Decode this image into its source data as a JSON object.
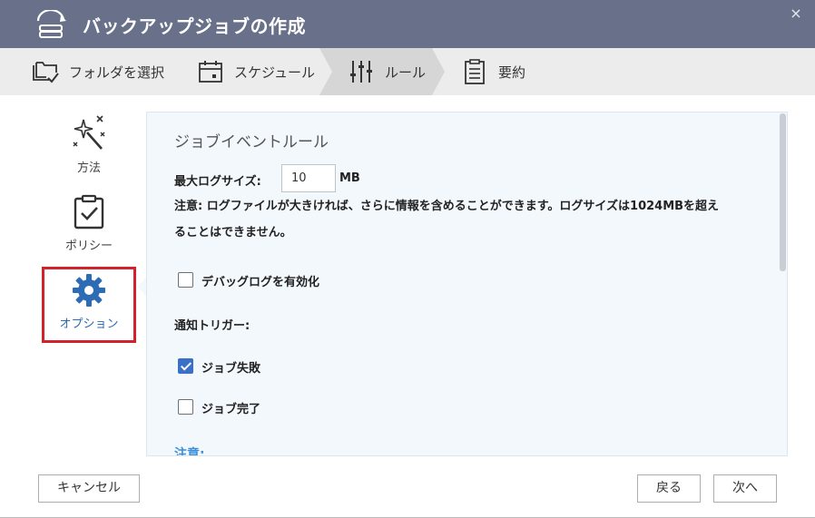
{
  "window": {
    "title": "バックアップジョブの作成",
    "close_icon": "×"
  },
  "steps": [
    {
      "label": "フォルダを選択",
      "icon": "folder-check-icon"
    },
    {
      "label": "スケジュール",
      "icon": "calendar-icon"
    },
    {
      "label": "ルール",
      "icon": "sliders-icon",
      "active": true
    },
    {
      "label": "要約",
      "icon": "clipboard-list-icon"
    }
  ],
  "nav": {
    "items": [
      {
        "label": "方法",
        "icon": "magic-wand-icon"
      },
      {
        "label": "ポリシー",
        "icon": "clipboard-check-icon"
      },
      {
        "label": "オプション",
        "icon": "gear-icon",
        "active": true
      }
    ]
  },
  "content": {
    "section_title": "ジョブイベントルール",
    "max_log_label": "最大ログサイズ:",
    "max_log_value": "10",
    "max_log_unit": "MB",
    "note_line1": "注意: ログファイルが大きければ、さらに情報を含めることができます。ログサイズは1024MBを超え",
    "note_line2": "ることはできません。",
    "debug_log_label": "デバッグログを有効化",
    "debug_log_checked": false,
    "notify_trigger_label": "通知トリガー:",
    "job_failed_label": "ジョブ失敗",
    "job_failed_checked": true,
    "job_complete_label": "ジョブ完了",
    "job_complete_checked": false,
    "bottom_note": "注意:"
  },
  "footer": {
    "cancel_label": "キャンセル",
    "back_label": "戻る",
    "next_label": "次へ"
  },
  "colors": {
    "titlebar": "#68708a",
    "highlight_border": "#d0232c",
    "checkbox_checked": "#3a70c8",
    "panel_bg": "#f3f8fd"
  }
}
